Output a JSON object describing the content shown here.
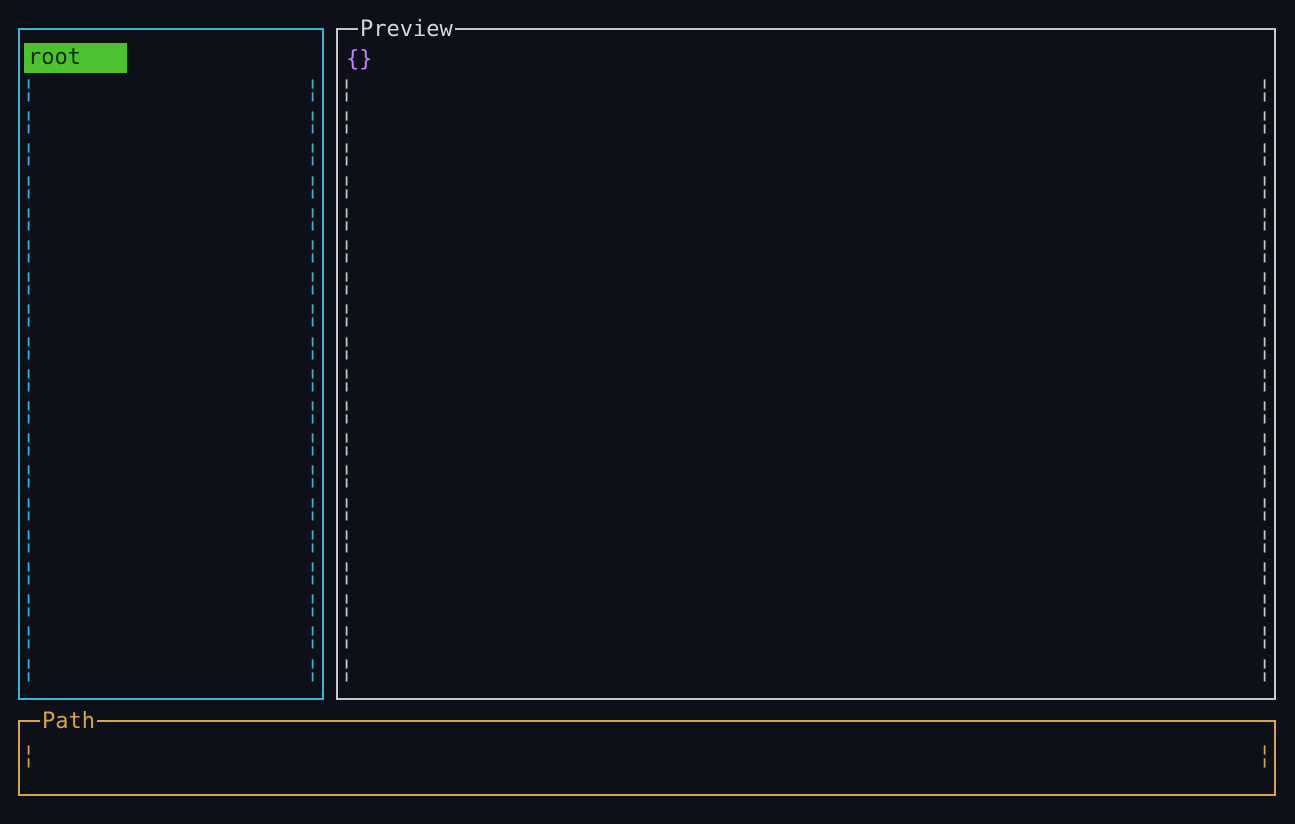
{
  "tree": {
    "items": [
      {
        "label": "root",
        "selected": true
      }
    ]
  },
  "preview": {
    "title": "Preview",
    "content": "{}"
  },
  "path": {
    "title": "Path",
    "value": ""
  },
  "glyphs": {
    "dash": "╎"
  },
  "colors": {
    "background": "#0d1117",
    "tree_border": "#38b6d8",
    "preview_border": "#c8c8c8",
    "path_border": "#d9a441",
    "selected_bg": "#4cc22e",
    "preview_content": "#c77dff"
  }
}
